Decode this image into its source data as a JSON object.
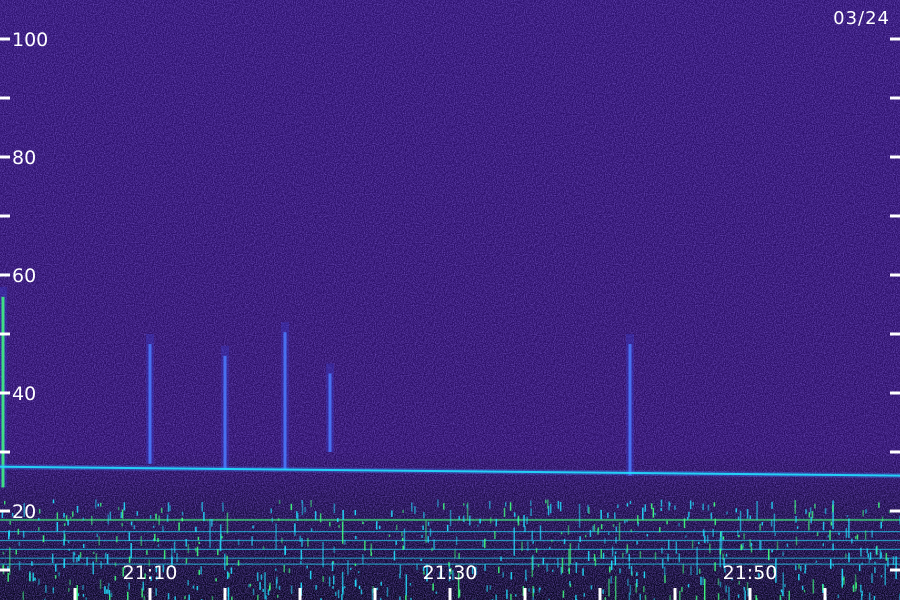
{
  "chart_data": {
    "type": "heatmap",
    "title": "",
    "date": "03/24",
    "ylabel": "",
    "xlabel": "",
    "ylim": [
      10,
      110
    ],
    "y_ticks": [
      20,
      40,
      60,
      80,
      100
    ],
    "y_minor_ticks": [
      10,
      30,
      50,
      70,
      90
    ],
    "x_ticks": [
      "21:10",
      "21:30",
      "21:50"
    ],
    "x_start": "21:00",
    "x_end": "21:60",
    "background_color": "#2a0d6e",
    "noise_color": "#3a1fa0",
    "signal_color": "#22e0ff",
    "strong_signal_color": "#40ff80",
    "horizontal_trace": {
      "y_start": 27.5,
      "y_end": 26
    },
    "vertical_streaks": [
      {
        "time": "21:00",
        "y_low": 24,
        "y_high": 58
      },
      {
        "time": "21:10",
        "y_low": 28,
        "y_high": 50
      },
      {
        "time": "21:15",
        "y_low": 27,
        "y_high": 48
      },
      {
        "time": "21:19",
        "y_low": 27,
        "y_high": 52
      },
      {
        "time": "21:22",
        "y_low": 30,
        "y_high": 45
      },
      {
        "time": "21:42",
        "y_low": 26,
        "y_high": 50
      }
    ]
  }
}
